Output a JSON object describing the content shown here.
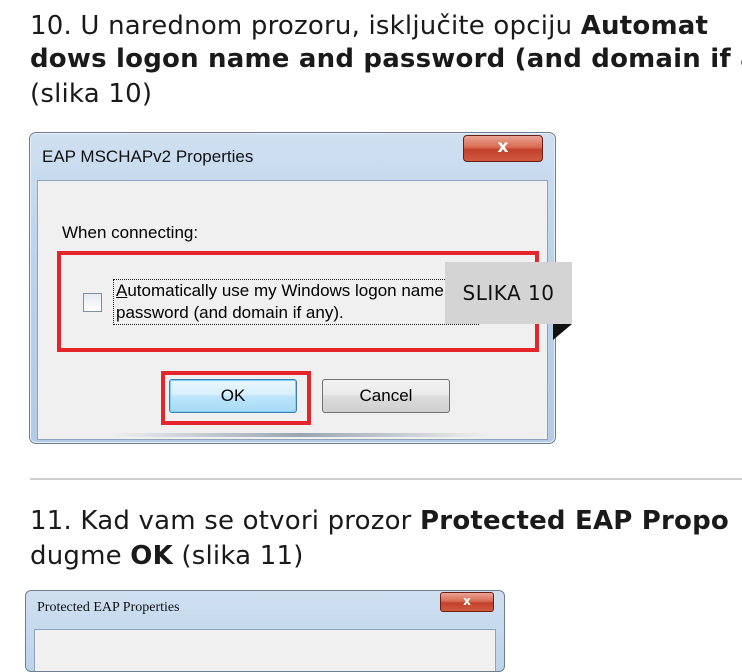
{
  "step10": {
    "line1_normal": "10. U narednom prozoru, isključite opciju ",
    "line1_bold": "Automat",
    "line2_bold": "dows logon name and password (and domain if a",
    "line3": "(slika 10)"
  },
  "dialog10": {
    "title": "EAP MSCHAPv2 Properties",
    "close_label": "x",
    "when_label": "When connecting:",
    "checkbox_line1_u": "A",
    "checkbox_line1_rest": "utomatically use my Windows logon name and",
    "checkbox_line2": "password (and domain if any).",
    "checkbox_checked": false,
    "ok_label": "OK",
    "cancel_label": "Cancel"
  },
  "callout": {
    "label": "SLIKA 10"
  },
  "step11": {
    "line1_normal": "11. Kad vam se otvori prozor ",
    "line1_bold": "Protected EAP Propo",
    "line2_normal": "dugme ",
    "line2_bold": "OK",
    "line2_rest": " (slika 11)"
  },
  "dialog11": {
    "title": "Protected EAP Properties",
    "close_label": "x"
  },
  "colors": {
    "highlight_red": "#e4252b",
    "callout_gray": "#d4d4d4",
    "text": "#1a1a1a"
  }
}
